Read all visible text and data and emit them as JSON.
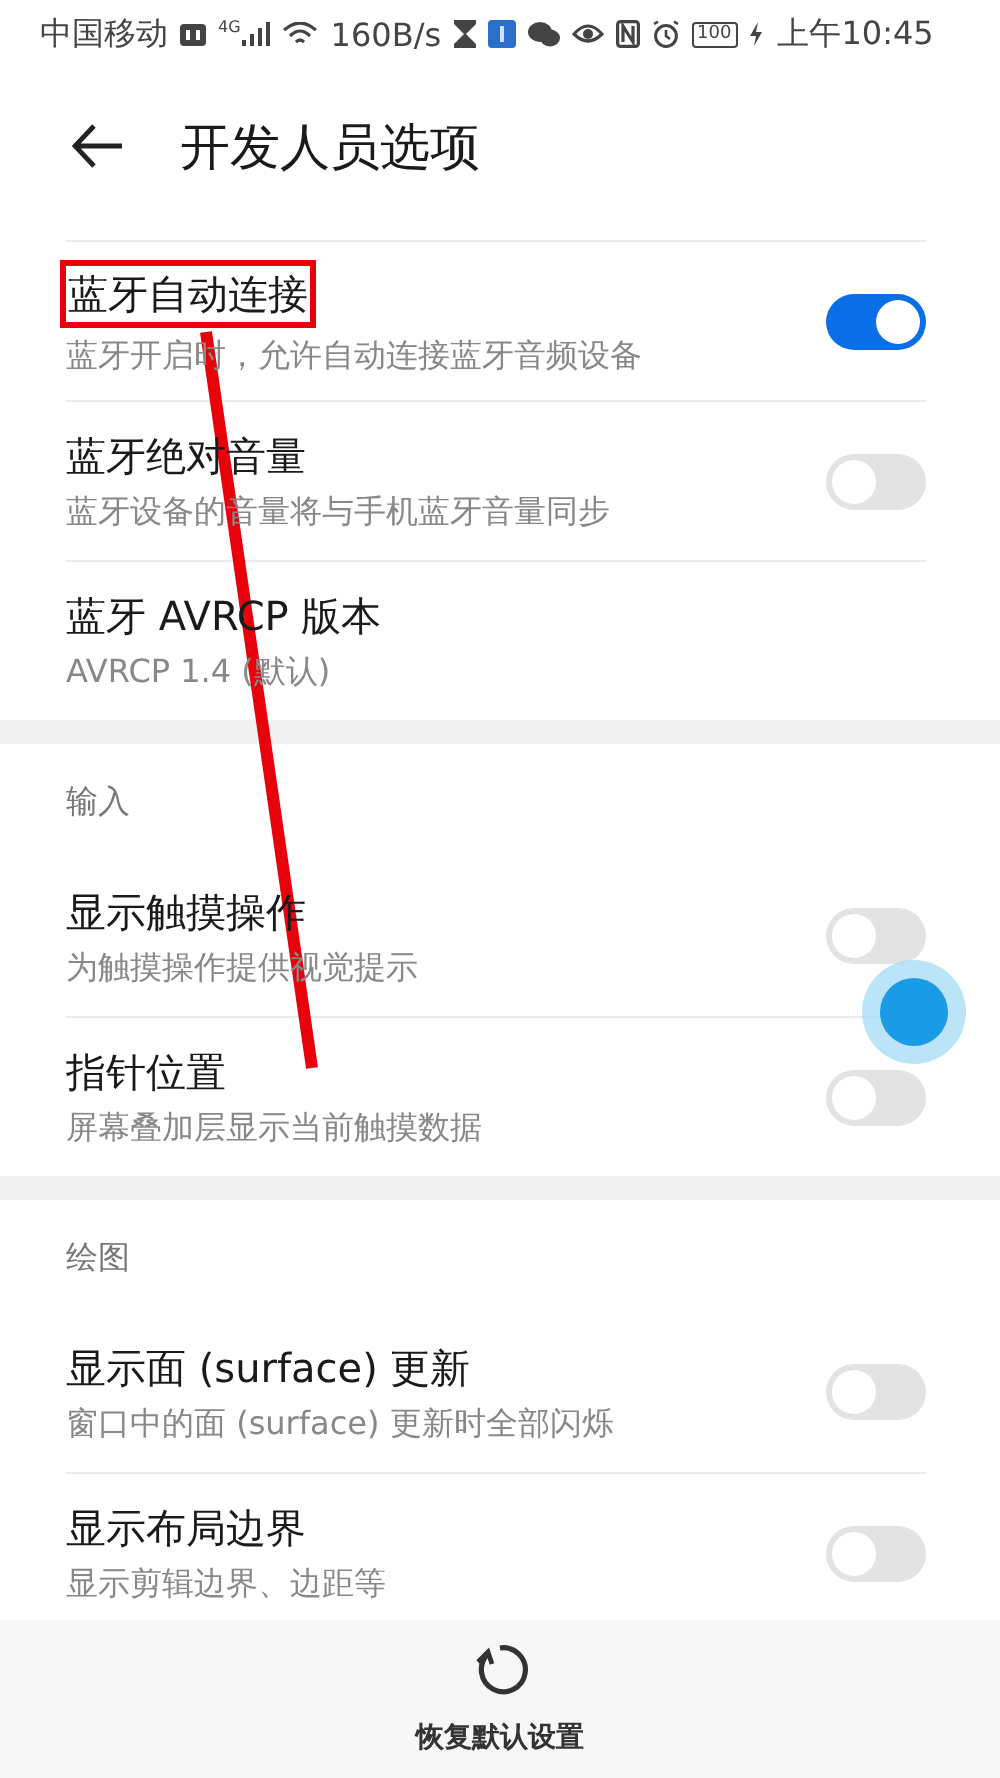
{
  "status_bar": {
    "carrier": "中国移动",
    "network": "4G",
    "speed": "160B/s",
    "battery": "100",
    "time": "上午10:45"
  },
  "header": {
    "title": "开发人员选项"
  },
  "sections": [
    {
      "items": [
        {
          "kind": "switch",
          "title": "蓝牙自动连接",
          "subtitle": "蓝牙开启时，允许自动连接蓝牙音频设备",
          "on": true,
          "highlighted": true
        },
        {
          "kind": "switch",
          "title": "蓝牙绝对音量",
          "subtitle": "蓝牙设备的音量将与手机蓝牙音量同步",
          "on": false,
          "highlighted": false
        },
        {
          "kind": "value",
          "title": "蓝牙 AVRCP 版本",
          "subtitle": "AVRCP 1.4 (默认)",
          "highlighted": false
        }
      ]
    },
    {
      "heading": "输入",
      "items": [
        {
          "kind": "switch",
          "title": "显示触摸操作",
          "subtitle": "为触摸操作提供视觉提示",
          "on": false,
          "highlighted": false
        },
        {
          "kind": "switch",
          "title": "指针位置",
          "subtitle": "屏幕叠加层显示当前触摸数据",
          "on": false,
          "highlighted": false
        }
      ]
    },
    {
      "heading": "绘图",
      "items": [
        {
          "kind": "switch",
          "title": "显示面 (surface) 更新",
          "subtitle": "窗口中的面 (surface) 更新时全部闪烁",
          "on": false,
          "highlighted": false
        },
        {
          "kind": "switch",
          "title": "显示布局边界",
          "subtitle": "显示剪辑边界、边距等",
          "on": false,
          "highlighted": false
        }
      ]
    }
  ],
  "bottom_action": {
    "label": "恢复默认设置"
  }
}
